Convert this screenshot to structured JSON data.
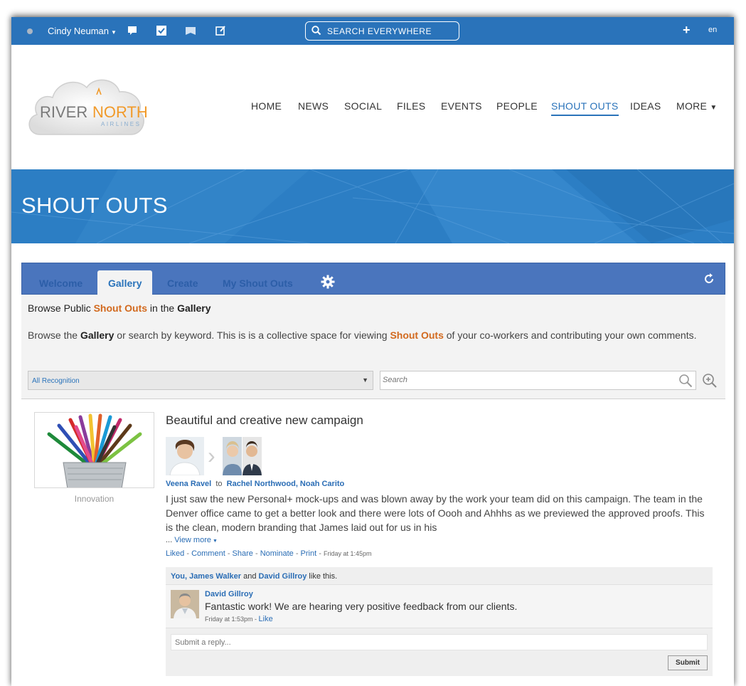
{
  "topbar": {
    "user_name": "Cindy Neuman",
    "search_label": "SEARCH EVERYWHERE",
    "add_label": "+",
    "language": "en"
  },
  "logo": {
    "line1": "RIVERNORTH",
    "line2": "AIRLINES"
  },
  "nav": {
    "items": [
      "HOME",
      "NEWS",
      "SOCIAL",
      "FILES",
      "EVENTS",
      "PEOPLE",
      "SHOUT OUTS",
      "IDEAS",
      "MORE"
    ],
    "active": "SHOUT OUTS"
  },
  "banner": {
    "title": "SHOUT OUTS"
  },
  "tabs": {
    "items": [
      "Welcome",
      "Gallery",
      "Create",
      "My Shout Outs"
    ],
    "active": "Gallery"
  },
  "intro": {
    "line1_a": "Browse Public ",
    "line1_b": "Shout Outs",
    "line1_c": " in the ",
    "line1_d": "Gallery",
    "line2_a": "Browse the ",
    "line2_b": "Gallery",
    "line2_c": " or search by keyword. This is is a collective space for viewing ",
    "line2_d": "Shout Outs",
    "line2_e": " of your co-workers and contributing your own comments."
  },
  "filter": {
    "selected": "All Recognition",
    "search_placeholder": "Search"
  },
  "post": {
    "category": "Innovation",
    "title": "Beautiful and creative new campaign",
    "from": "Veena Ravel",
    "to_word": "to",
    "recipients": "Rachel Northwood, Noah Carito",
    "body": "I just saw the new Personal+ mock-ups and was blown away by the work your team did on this campaign. The team in the Denver office came to get a better look and there were lots of Oooh and Ahhhs as we previewed the approved proofs. This is the clean, modern branding that James laid out for us in his",
    "ellipsis": "... ",
    "view_more": "View more",
    "actions": [
      "Liked",
      "Comment",
      "Share",
      "Nominate",
      "Print"
    ],
    "time": "Friday at 1:45pm",
    "likes_names": "You, James Walker",
    "likes_and": " and ",
    "likes_other": "David Gillroy",
    "likes_suffix": " like this.",
    "comment": {
      "author": "David Gillroy",
      "text": "Fantastic work! We are hearing very positive feedback from our clients.",
      "time": "Friday at 1:53pm",
      "like": "Like"
    },
    "reply_placeholder": "Submit a reply...",
    "submit_label": "Submit"
  },
  "colors": {
    "topbar": "#2a73ba",
    "tabbar": "#4a75bd",
    "accent_orange": "#d2691e",
    "link": "#2a6db5"
  }
}
